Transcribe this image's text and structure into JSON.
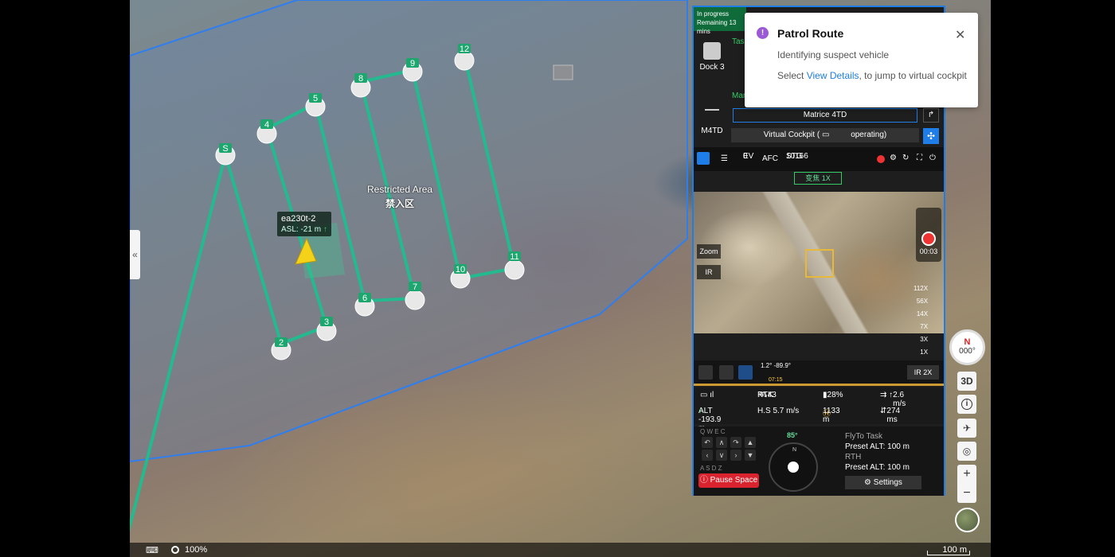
{
  "map": {
    "restricted_label": "Restricted Area",
    "restricted_label_cn": "禁入区",
    "drone_tag": "ea230t-2",
    "drone_asl": "ASL: -21 m",
    "drone_asl_arrow": "↑",
    "waypoints": [
      "S",
      "2",
      "3",
      "4",
      "5",
      "6",
      "7",
      "8",
      "9",
      "10",
      "11",
      "12"
    ],
    "collapse_icon": "«",
    "zoom_level": "100%",
    "scale_text": "100 m"
  },
  "controls": {
    "compass_n": "N",
    "compass_deg": "000°",
    "btn_3d": "3D",
    "btn_info": "i",
    "zoom_in": "+",
    "zoom_out": "−"
  },
  "panel": {
    "status": "In progress",
    "status_remaining": "Remaining 13 mins",
    "dock_label": "Dock 3",
    "task_label": "Task",
    "manual_label": "Man",
    "aircraft_label": "M4TD",
    "model": "Matrice 4TD",
    "cockpit_label": "Virtual Cockpit  (",
    "cockpit_state": "operating)",
    "ev_label": "EV",
    "ev_value": "0",
    "afc": "AFC",
    "stg_label": "STG",
    "stg_value": "10166",
    "zoom_tag": "变焦 1X",
    "btn_zoom": "Zoom",
    "btn_ir": "IR",
    "rec_time": "00:03",
    "zoom_levels": [
      "112X",
      "56X",
      "14X",
      "7X",
      "3X",
      "1X"
    ],
    "gimbal_angle": "1.2° -89.9°",
    "time_marker": "07:15",
    "ir_2x": "IR  2X",
    "rtk_label": "RTK",
    "rtk_value": "43",
    "battery": "28%",
    "vs": "2.6 m/s",
    "alt": "ALT -193.9 m",
    "hs": "H.S 5.7 m/s",
    "home_dist": "1133 m",
    "alt2": "274 ms",
    "keys_top": "Q W E C",
    "keys_bottom": "A S D Z",
    "pause_label": "Pause Space",
    "heading": "85°",
    "flyto_label": "FlyTo Task",
    "flyto_alt": "Preset ALT: 100 m",
    "rth_label": "RTH",
    "rth_alt": "Preset ALT: 100 m",
    "settings_label": "Settings"
  },
  "toast": {
    "title": "Patrol Route",
    "message": "Identifying suspect vehicle",
    "line2_prefix": "Select ",
    "line2_link": "View Details",
    "line2_suffix": ", to jump to virtual cockpit",
    "close_icon": "✕"
  },
  "colors": {
    "accent": "#1e7de6",
    "route": "#24b98f",
    "pause_red": "#d9232f",
    "toast_icon": "#9b59d6"
  }
}
